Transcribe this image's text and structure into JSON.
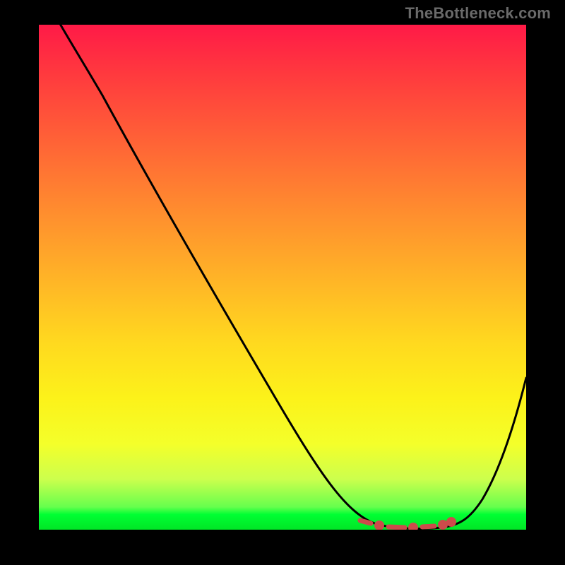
{
  "watermark": "TheBottleneck.com",
  "chart_data": {
    "type": "line",
    "title": "",
    "xlabel": "",
    "ylabel": "",
    "xlim": [
      0,
      100
    ],
    "ylim": [
      0,
      100
    ],
    "grid": false,
    "legend": false,
    "series": [
      {
        "name": "curve",
        "x": [
          0,
          4,
          10,
          18,
          26,
          34,
          42,
          50,
          56,
          62,
          66,
          70,
          74,
          78,
          82,
          86,
          90,
          94,
          98,
          100
        ],
        "values": [
          108,
          100,
          91,
          80,
          68,
          57,
          46,
          35,
          26,
          16,
          9,
          4,
          1,
          0,
          0,
          1,
          6,
          14,
          24,
          30
        ]
      }
    ],
    "valley_markers": {
      "name": "valley-dots",
      "x": [
        66,
        69,
        73,
        77,
        81,
        85
      ],
      "values": [
        2,
        1,
        0,
        0,
        0,
        1
      ]
    },
    "colors": {
      "curve": "#000000",
      "markers": "#cc4b4b",
      "gradient_top": "#ff1a47",
      "gradient_bottom": "#00e626"
    }
  }
}
